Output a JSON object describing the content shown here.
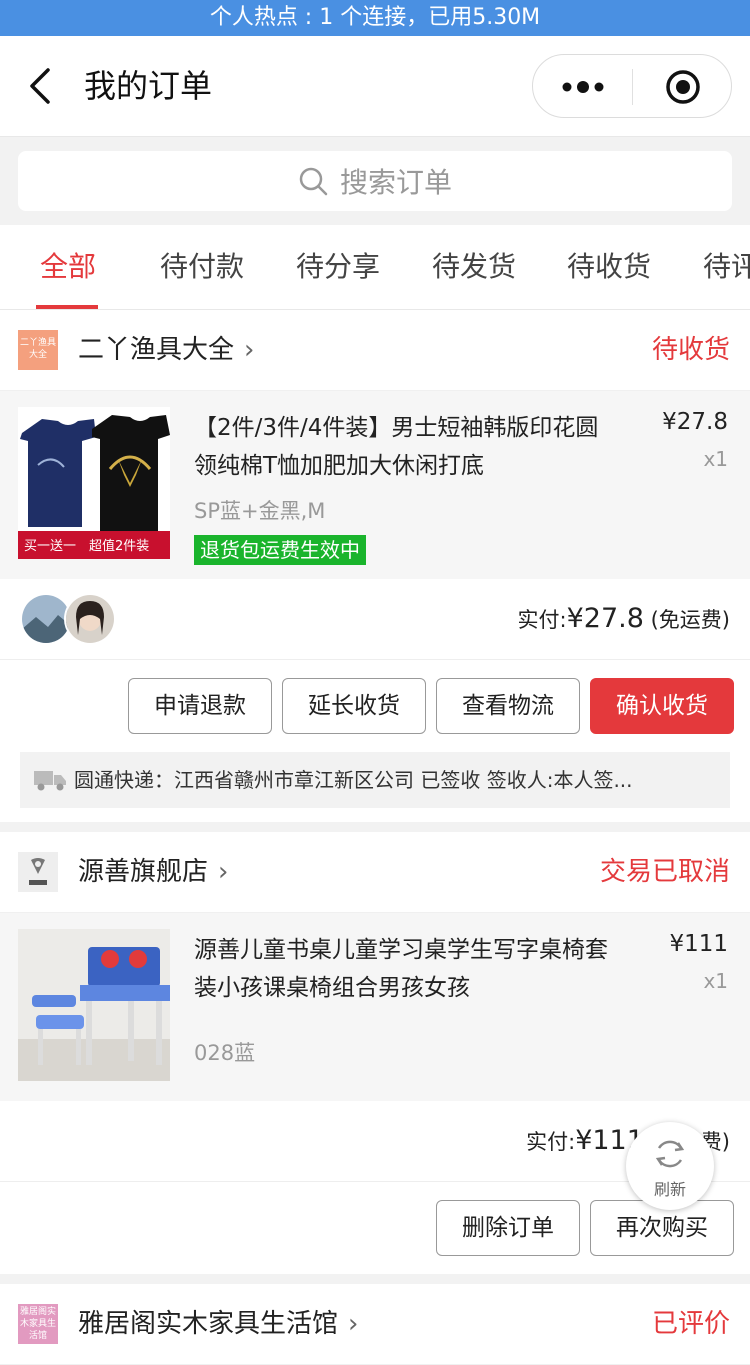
{
  "statusbar": {
    "text": "个人热点 : 1 个连接，已用5.30M"
  },
  "navbar": {
    "title": "我的订单"
  },
  "search": {
    "placeholder": "搜索订单"
  },
  "tabs": [
    "全部",
    "待付款",
    "待分享",
    "待发货",
    "待收货",
    "待评"
  ],
  "colors": {
    "accent": "#e4393c",
    "tag_green": "#1ab42c",
    "hotspot_bar": "#4a90e2"
  },
  "orders": [
    {
      "shop": {
        "name": "二丫渔具大全",
        "logo_text": "二丫渔具大全",
        "status": "待收货"
      },
      "product": {
        "title": "【2件/3件/4件装】男士短袖韩版印花圆领纯棉T恤加肥加大休闲打底",
        "spec": "SP蓝+金黑,M",
        "tag": "退货包运费生效中",
        "price": "¥27.8",
        "qty": "x1",
        "thumb_caption": "买一送一　超值2件装"
      },
      "paid": {
        "label": "实付:",
        "amount": "¥27.8",
        "note": "(免运费)"
      },
      "buttons": [
        "申请退款",
        "延长收货",
        "查看物流",
        "确认收货"
      ],
      "logistics": "圆通快递：江西省赣州市章江新区公司 已签收 签收人:本人签..."
    },
    {
      "shop": {
        "name": "源善旗舰店",
        "status": "交易已取消"
      },
      "product": {
        "title": "源善儿童书桌儿童学习桌学生写字桌椅套装小孩课桌椅组合男孩女孩",
        "spec": "028蓝",
        "price": "¥111",
        "qty": "x1"
      },
      "paid": {
        "label": "实付:",
        "amount": "¥111",
        "note": "(免运费)"
      },
      "buttons": [
        "删除订单",
        "再次购买"
      ]
    },
    {
      "shop": {
        "name": "雅居阁实木家具生活馆",
        "logo_text": "雅居阁实木家具生活馆",
        "status": "已评价"
      }
    }
  ],
  "refresh": {
    "label": "刷新"
  }
}
